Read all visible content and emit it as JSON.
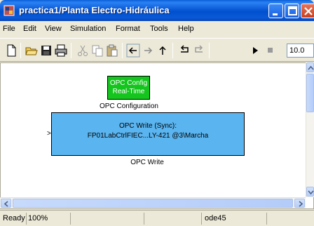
{
  "window": {
    "title": "practica1/Planta Electro-Hidráulica"
  },
  "menu": {
    "items": [
      {
        "label": "File",
        "key": "F"
      },
      {
        "label": "Edit",
        "key": "E"
      },
      {
        "label": "View",
        "key": "V"
      },
      {
        "label": "Simulation",
        "key": "S"
      },
      {
        "label": "Format",
        "key": "o"
      },
      {
        "label": "Tools",
        "key": "T"
      },
      {
        "label": "Help",
        "key": "H"
      }
    ]
  },
  "toolbar": {
    "icons": [
      "new-model-icon",
      "open-icon",
      "save-icon",
      "print-icon",
      "cut-icon",
      "copy-icon",
      "paste-icon",
      "back-icon",
      "forward-icon",
      "up-icon",
      "undo-icon",
      "redo-icon",
      "play-icon",
      "stop-icon"
    ],
    "stop_time": "10.0"
  },
  "canvas": {
    "config_block": {
      "line1": "OPC Config",
      "line2": "Real-Time",
      "caption": "OPC Configuration",
      "color": "#13c51c"
    },
    "write_block": {
      "line1": "OPC Write (Sync):",
      "line2": "FP01LabCtrlFIEC...LY-421 @3\\Marcha",
      "caption": "OPC Write",
      "color": "#5ab4ef",
      "input_port": ">"
    }
  },
  "status": {
    "ready": "Ready",
    "zoom": "100%",
    "solver": "ode45"
  }
}
